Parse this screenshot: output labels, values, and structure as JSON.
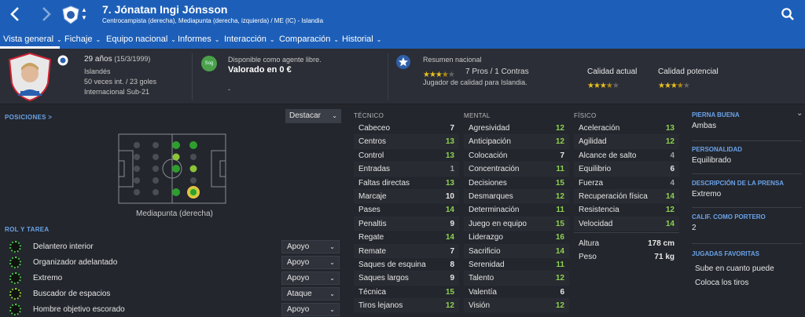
{
  "topbar": {
    "back_icon": "chevron-left-icon",
    "forward_icon": "chevron-right-icon",
    "player_name": "7. Jónatan Ingi Jónsson",
    "positions": "Centrocampista (derecha), Mediapunta (derecha, izquierda) / ME (IC) - Islandia",
    "search_icon": "search-icon"
  },
  "tabs": [
    {
      "label": "Vista general"
    },
    {
      "label": "Fichaje"
    },
    {
      "label": "Equipo nacional"
    },
    {
      "label": "Informes"
    },
    {
      "label": "Interacción"
    },
    {
      "label": "Comparación"
    },
    {
      "label": "Historial"
    }
  ],
  "header": {
    "age": "29 años",
    "dob": "(15/3/1999)",
    "nationality": "Islandés",
    "caps": "50 veces int. / 23 goles",
    "youth": "Internacional Sub-21",
    "badge": "Sog",
    "contract_status": "Disponible como agente libre.",
    "value": "Valorado en 0 €",
    "value_extra": "-",
    "national_title": "Resumen nacional",
    "pros_cons": "7 Pros / 1 Contras",
    "national_note": "Jugador de calidad para Islandia.",
    "national_stars": 3.5,
    "current_ability_label": "Calidad actual",
    "current_ability_stars": 3.5,
    "potential_ability_label": "Calidad potencial",
    "potential_ability_stars": 3.5
  },
  "positions_panel": {
    "title": "POSICIONES >",
    "highlight_label": "Destacar",
    "position_label": "Mediapunta (derecha)"
  },
  "roles": {
    "title": "ROL Y TAREA",
    "items": [
      {
        "name": "Delantero interior",
        "duty": "Apoyo"
      },
      {
        "name": "Organizador adelantado",
        "duty": "Apoyo"
      },
      {
        "name": "Extremo",
        "duty": "Apoyo"
      },
      {
        "name": "Buscador de espacios",
        "duty": "Ataque"
      },
      {
        "name": "Hombre objetivo escorado",
        "duty": "Apoyo"
      }
    ]
  },
  "technical": {
    "title": "TÉCNICO",
    "items": [
      {
        "name": "Cabeceo",
        "value": "7"
      },
      {
        "name": "Centros",
        "value": "13"
      },
      {
        "name": "Control",
        "value": "13"
      },
      {
        "name": "Entradas",
        "value": "1"
      },
      {
        "name": "Faltas directas",
        "value": "13"
      },
      {
        "name": "Marcaje",
        "value": "10"
      },
      {
        "name": "Pases",
        "value": "14"
      },
      {
        "name": "Penaltis",
        "value": "9"
      },
      {
        "name": "Regate",
        "value": "14"
      },
      {
        "name": "Remate",
        "value": "7"
      },
      {
        "name": "Saques de esquina",
        "value": "8"
      },
      {
        "name": "Saques largos",
        "value": "9"
      },
      {
        "name": "Técnica",
        "value": "15"
      },
      {
        "name": "Tiros lejanos",
        "value": "12"
      }
    ]
  },
  "mental": {
    "title": "MENTAL",
    "items": [
      {
        "name": "Agresividad",
        "value": "12"
      },
      {
        "name": "Anticipación",
        "value": "12"
      },
      {
        "name": "Colocación",
        "value": "7"
      },
      {
        "name": "Concentración",
        "value": "11"
      },
      {
        "name": "Decisiones",
        "value": "15"
      },
      {
        "name": "Desmarques",
        "value": "12"
      },
      {
        "name": "Determinación",
        "value": "11"
      },
      {
        "name": "Juego en equipo",
        "value": "15"
      },
      {
        "name": "Liderazgo",
        "value": "16"
      },
      {
        "name": "Sacrificio",
        "value": "14"
      },
      {
        "name": "Serenidad",
        "value": "11"
      },
      {
        "name": "Talento",
        "value": "12"
      },
      {
        "name": "Valentía",
        "value": "6"
      },
      {
        "name": "Visión",
        "value": "12"
      }
    ]
  },
  "physical": {
    "title": "FÍSICO",
    "items": [
      {
        "name": "Aceleración",
        "value": "13"
      },
      {
        "name": "Agilidad",
        "value": "12"
      },
      {
        "name": "Alcance de salto",
        "value": "4"
      },
      {
        "name": "Equilibrio",
        "value": "6"
      },
      {
        "name": "Fuerza",
        "value": "4"
      },
      {
        "name": "Recuperación física",
        "value": "14"
      },
      {
        "name": "Resistencia",
        "value": "12"
      },
      {
        "name": "Velocidad",
        "value": "14"
      }
    ],
    "height_label": "Altura",
    "height": "178 cm",
    "weight_label": "Peso",
    "weight": "71 kg"
  },
  "sidebar": {
    "foot_title": "PIERNA BUENA",
    "foot": "Ambas",
    "personality_title": "PERSONALIDAD",
    "personality": "Equilibrado",
    "press_title": "DESCRIPCIÓN DE LA PRENSA",
    "press": "Extremo",
    "gk_title": "CALIF. COMO PORTERO",
    "gk": "2",
    "traits_title": "JUGADAS FAVORITAS",
    "traits": [
      "Sube en cuanto puede",
      "Coloca los tiros"
    ]
  },
  "colors": {
    "accent": "#1d5fb8",
    "high": "#8fd14f",
    "mid": "#e6e6e6",
    "low": "#a0a0a0"
  }
}
